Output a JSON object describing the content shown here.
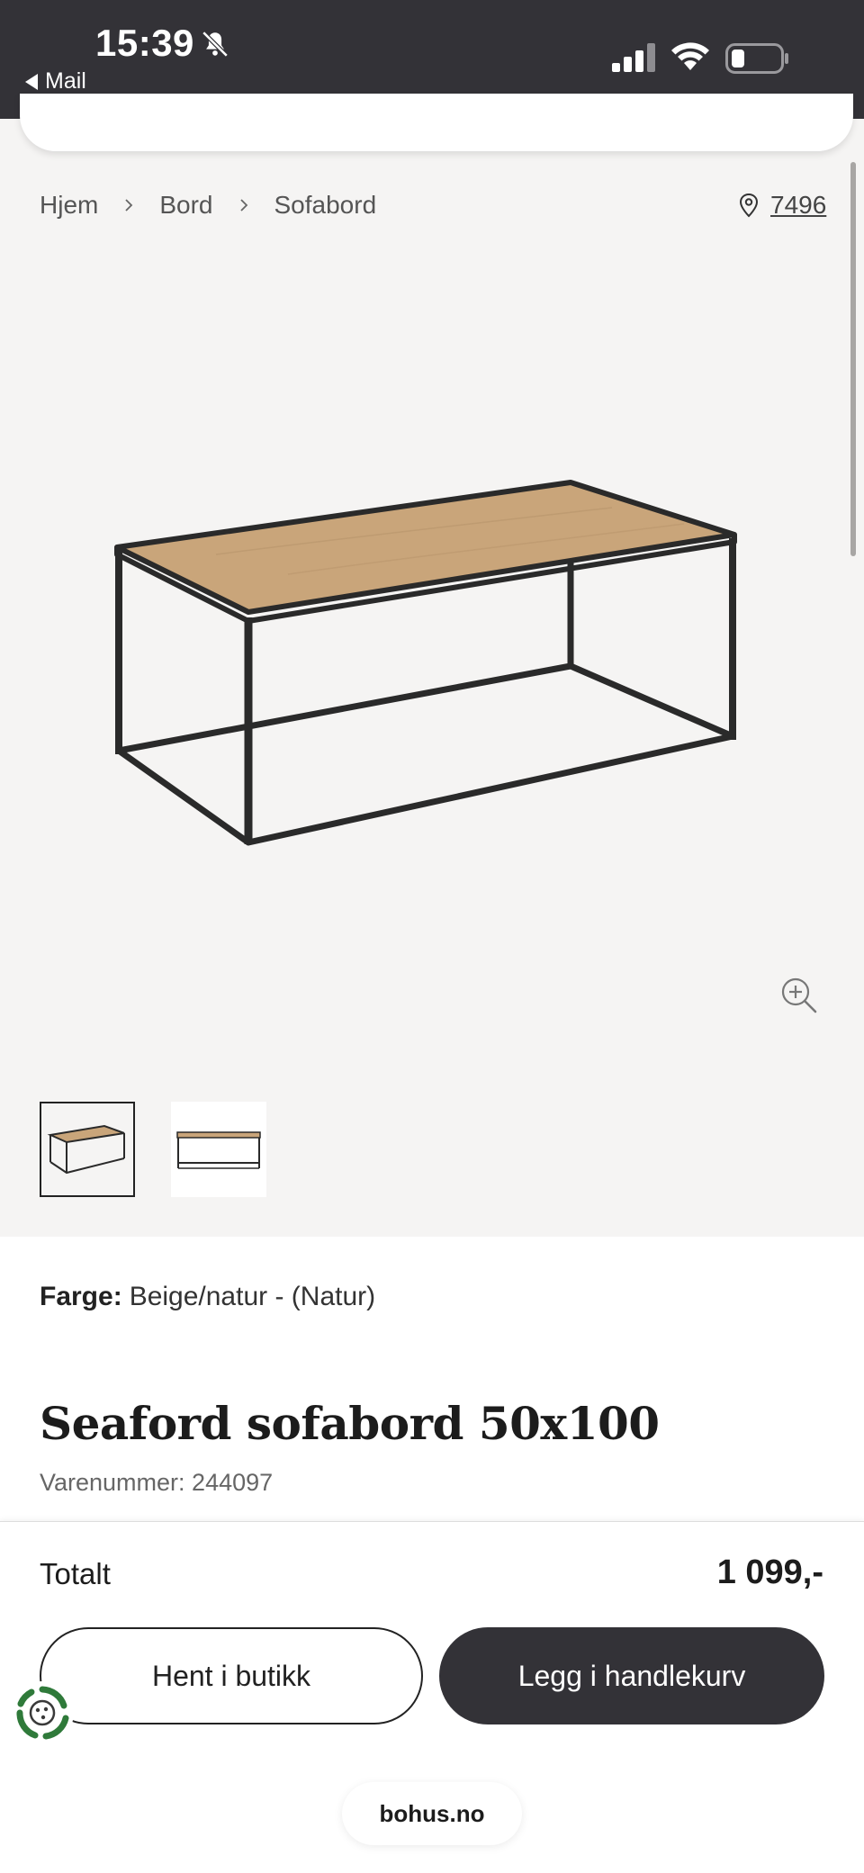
{
  "status_bar": {
    "time": "15:39",
    "back_app": "Mail",
    "icons": [
      "bell-muted-icon",
      "signal-icon",
      "wifi-icon",
      "battery-icon"
    ]
  },
  "breadcrumb": {
    "items": [
      "Hjem",
      "Bord",
      "Sofabord"
    ]
  },
  "store": {
    "number": "7496",
    "icon": "location-pin-icon"
  },
  "product": {
    "image_alt_icon": "coffee-table-image",
    "thumbnails": 2,
    "color_label": "Farge:",
    "color_value": "Beige/natur - (Natur)",
    "title": "Seaford sofabord 50x100",
    "sku": "Varenummer: 244097"
  },
  "purchase": {
    "total_label": "Totalt",
    "total_value": "1 099,-",
    "pickup_button": "Hent i butikk",
    "cart_button": "Legg i handlekurv"
  },
  "browser": {
    "url": "bohus.no"
  },
  "colors": {
    "dark": "#333237",
    "background": "#f5f4f3",
    "table_top": "#c9a57a",
    "frame": "#2a2a2a"
  }
}
